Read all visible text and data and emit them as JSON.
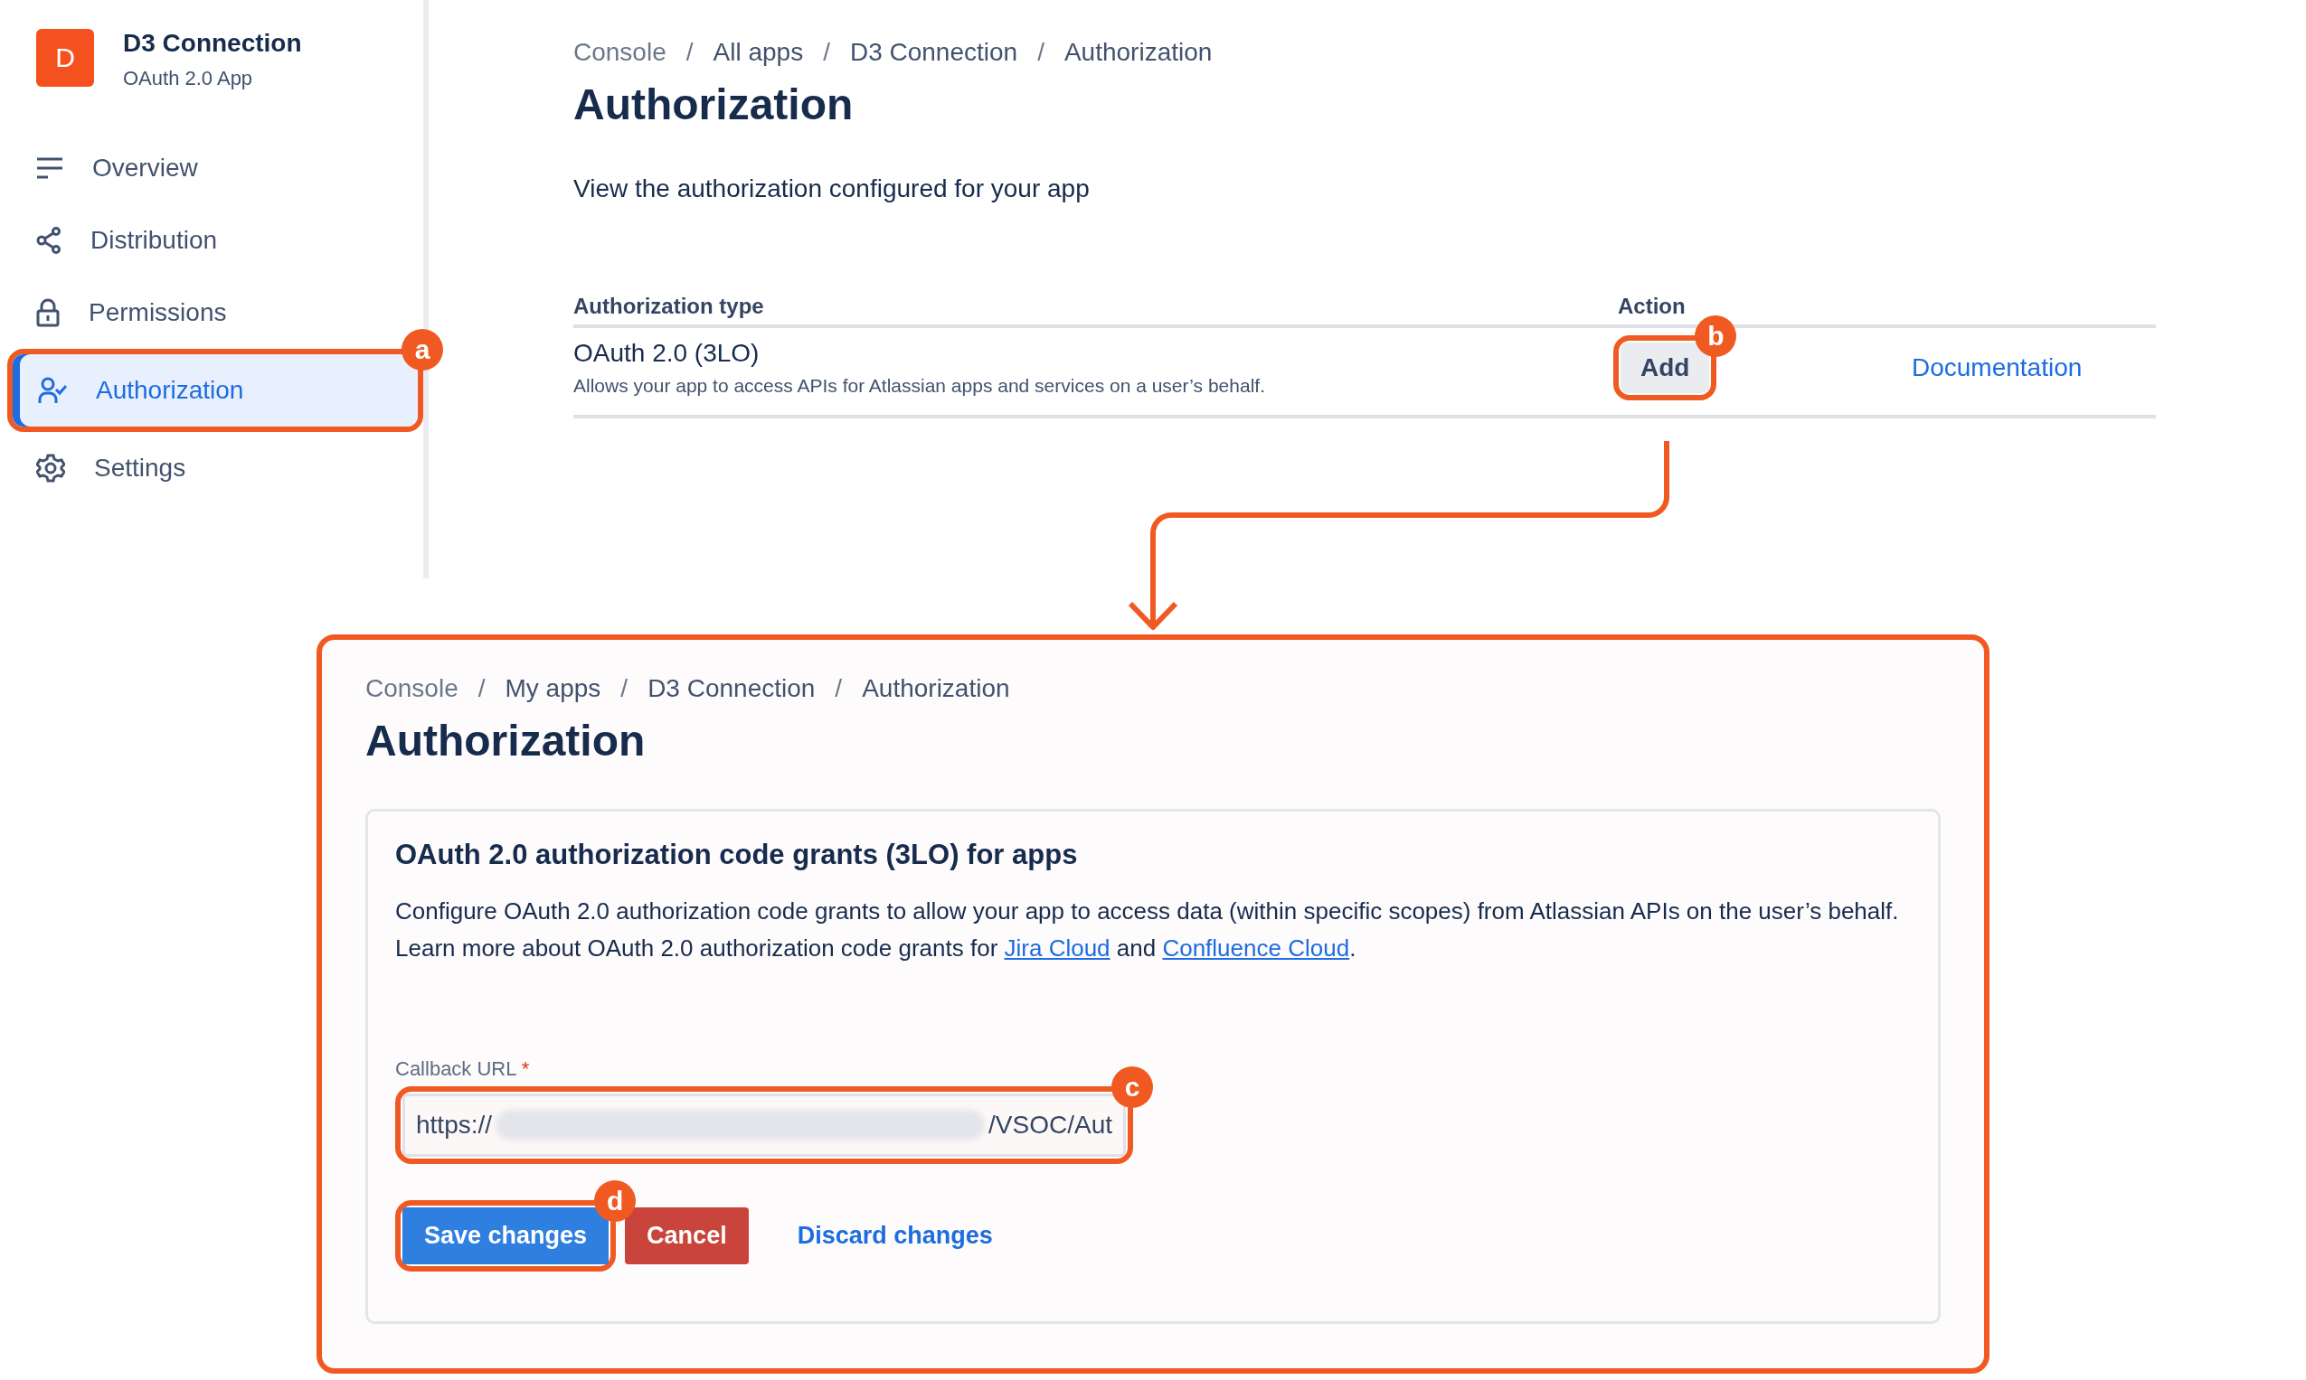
{
  "app": {
    "initial": "D",
    "name": "D3 Connection",
    "type": "OAuth 2.0 App"
  },
  "sidebar": {
    "items": [
      {
        "label": "Overview",
        "selected": false
      },
      {
        "label": "Distribution",
        "selected": false
      },
      {
        "label": "Permissions",
        "selected": false
      },
      {
        "label": "Authorization",
        "selected": true,
        "callout": "a"
      },
      {
        "label": "Settings",
        "selected": false
      }
    ]
  },
  "page": {
    "breadcrumb": {
      "separator": "/",
      "items": [
        "Console",
        "All apps",
        "D3 Connection",
        "Authorization"
      ]
    },
    "title": "Authorization",
    "description": "View the authorization configured for your app",
    "table": {
      "columns": [
        "Authorization type",
        "Action"
      ],
      "rows": [
        {
          "type": "OAuth 2.0 (3LO)",
          "description": "Allows your app to access APIs for Atlassian apps and services on a user’s behalf.",
          "action": "Add",
          "action_callout": "b",
          "link": "Documentation"
        }
      ]
    }
  },
  "detail": {
    "breadcrumb": {
      "separator": "/",
      "items": [
        "Console",
        "My apps",
        "D3 Connection",
        "Authorization"
      ]
    },
    "title": "Authorization",
    "card": {
      "title": "OAuth 2.0 authorization code grants (3LO) for apps",
      "paragraph": [
        {
          "text": "Configure OAuth 2.0 authorization code grants to allow your app to access data (within specific scopes) from Atlassian APIs on the user’s behalf. Learn more about OAuth 2.0 authorization code grants for "
        },
        {
          "link": "Jira Cloud"
        },
        {
          "text": " and "
        },
        {
          "link": "Confluence Cloud"
        },
        {
          "text": "."
        }
      ],
      "field": {
        "label": "Callback URL",
        "required_mark": "*",
        "value_start": "https://",
        "value_end": "/VSOC/Aut",
        "callout": "c"
      },
      "buttons": [
        {
          "kind": "primary",
          "label": "Save changes",
          "callout": "d"
        },
        {
          "kind": "danger",
          "label": "Cancel"
        },
        {
          "kind": "link",
          "label": "Discard changes"
        }
      ]
    }
  }
}
